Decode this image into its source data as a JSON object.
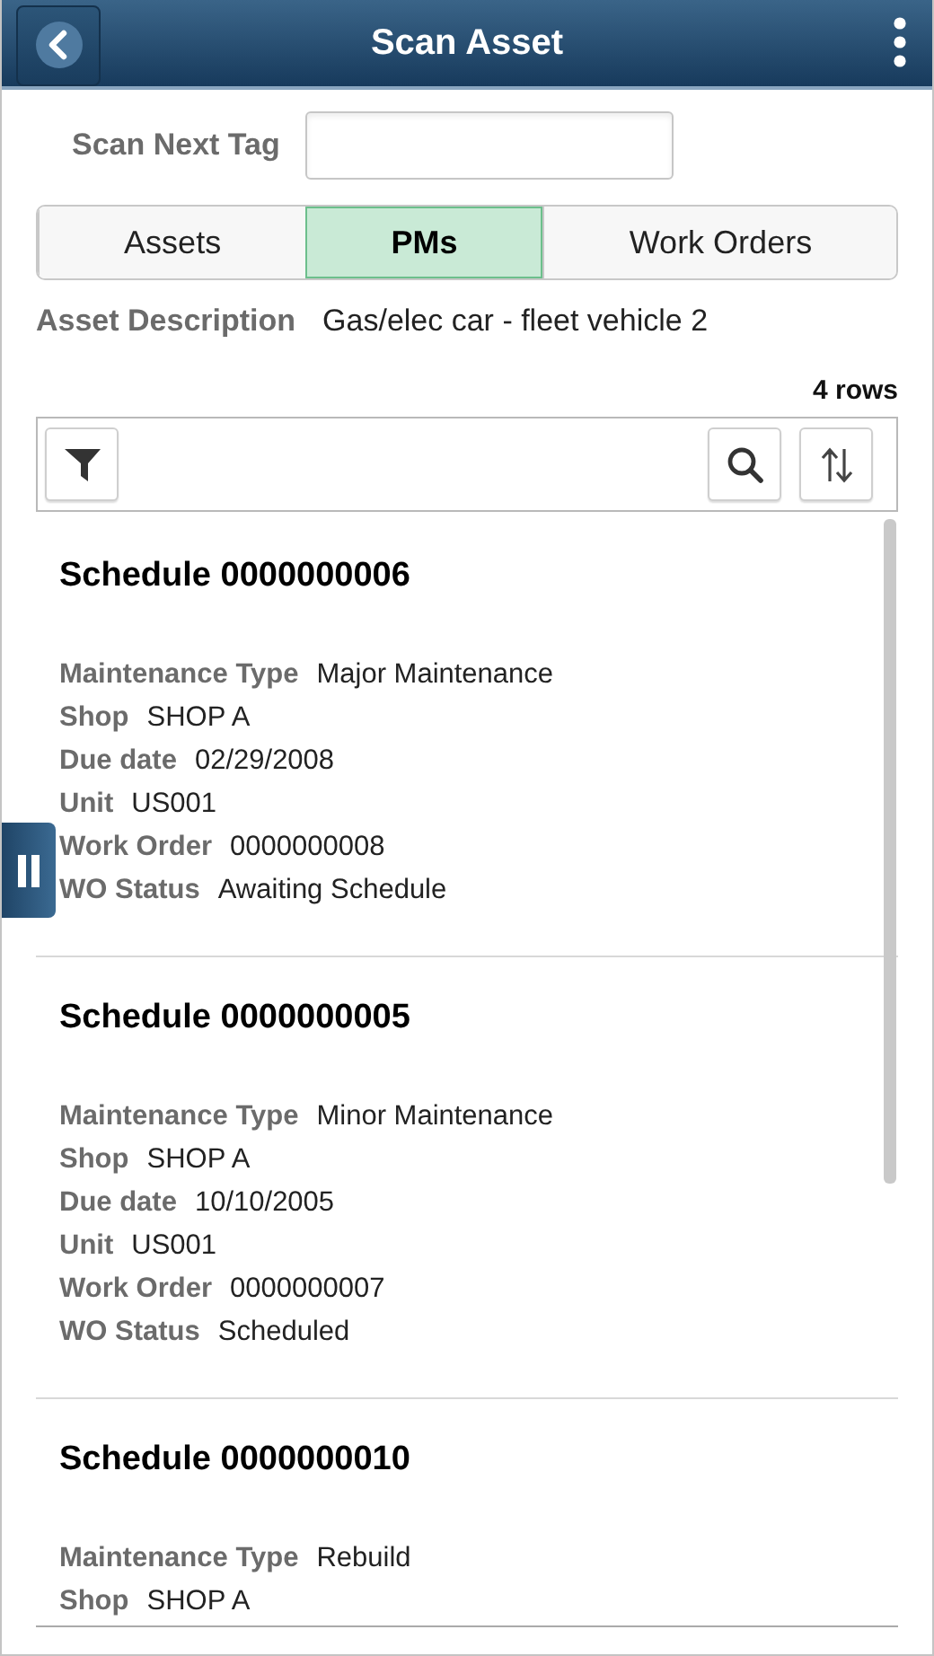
{
  "header": {
    "title": "Scan Asset"
  },
  "scan": {
    "label": "Scan Next Tag"
  },
  "tabs": [
    {
      "label": "Assets",
      "selected": false
    },
    {
      "label": "PMs",
      "selected": true
    },
    {
      "label": "Work Orders",
      "selected": false
    }
  ],
  "asset": {
    "label": "Asset Description",
    "value": "Gas/elec car - fleet vehicle 2"
  },
  "row_count": "4 rows",
  "schedules": [
    {
      "title": "Schedule 0000000006",
      "fields": [
        {
          "label": "Maintenance Type",
          "value": "Major Maintenance"
        },
        {
          "label": "Shop",
          "value": "SHOP A"
        },
        {
          "label": "Due date",
          "value": "02/29/2008"
        },
        {
          "label": "Unit",
          "value": "US001"
        },
        {
          "label": "Work Order",
          "value": "0000000008"
        },
        {
          "label": "WO Status",
          "value": "Awaiting Schedule"
        }
      ]
    },
    {
      "title": "Schedule 0000000005",
      "fields": [
        {
          "label": "Maintenance Type",
          "value": "Minor Maintenance"
        },
        {
          "label": "Shop",
          "value": "SHOP A"
        },
        {
          "label": "Due date",
          "value": "10/10/2005"
        },
        {
          "label": "Unit",
          "value": "US001"
        },
        {
          "label": "Work Order",
          "value": "0000000007"
        },
        {
          "label": "WO Status",
          "value": "Scheduled"
        }
      ]
    },
    {
      "title": "Schedule 0000000010",
      "fields": [
        {
          "label": "Maintenance Type",
          "value": "Rebuild"
        },
        {
          "label": "Shop",
          "value": "SHOP A"
        }
      ]
    }
  ]
}
